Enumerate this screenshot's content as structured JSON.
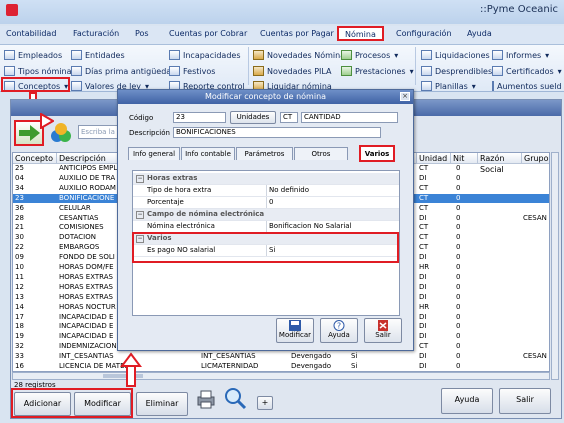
{
  "app": {
    "title": "::Pyme Oceanic"
  },
  "menu": [
    "Contabilidad",
    "Facturación",
    "Pos",
    "Cuentas por Cobrar",
    "Cuentas por Pagar",
    "Nómina",
    "Configuración",
    "Ayuda"
  ],
  "ribbon": {
    "col1": [
      "Empleados",
      "Tipos nómina",
      "Conceptos"
    ],
    "col2": [
      "Entidades",
      "Días prima antigüedad",
      "Valores de ley"
    ],
    "col3": [
      "Incapacidades",
      "Festivos",
      "Reporte control"
    ],
    "col4": [
      "Novedades Nómina",
      "Novedades PILA",
      "Liquidar nómina"
    ],
    "col5": [
      "Procesos",
      "Prestaciones"
    ],
    "col6": [
      "Liquidaciones",
      "Desprendibles",
      "Planillas"
    ],
    "col7": [
      "Informes",
      "Certificados",
      "Aumentos sueldo"
    ]
  },
  "toolbar": {
    "search_placeholder": "Escriba la"
  },
  "grid": {
    "headers": [
      "Concepto",
      "Descripción",
      "Unidad",
      "Nit",
      "Razón Social",
      "Grupo"
    ],
    "rows": [
      {
        "code": "25",
        "desc": "ANTICIPOS EMPL",
        "unit": "CT",
        "nit": "0",
        "rs": ""
      },
      {
        "code": "04",
        "desc": "AUXILIO DE TRA",
        "unit": "DI",
        "nit": "0",
        "rs": ""
      },
      {
        "code": "34",
        "desc": "AUXILIO RODAM",
        "unit": "CT",
        "nit": "0",
        "rs": ""
      },
      {
        "code": "23",
        "desc": "BONIFICACIONE",
        "unit": "CT",
        "nit": "0",
        "rs": "",
        "sel": true
      },
      {
        "code": "36",
        "desc": "CELULAR",
        "unit": "CT",
        "nit": "0",
        "rs": ""
      },
      {
        "code": "28",
        "desc": "CESANTIAS",
        "unit": "DI",
        "nit": "0",
        "rs": "CESAN"
      },
      {
        "code": "21",
        "desc": "COMISIONES",
        "unit": "CT",
        "nit": "0",
        "rs": ""
      },
      {
        "code": "30",
        "desc": "DOTACION",
        "unit": "CT",
        "nit": "0",
        "rs": ""
      },
      {
        "code": "22",
        "desc": "EMBARGOS",
        "unit": "CT",
        "nit": "0",
        "rs": ""
      },
      {
        "code": "09",
        "desc": "FONDO DE SOLI",
        "unit": "DI",
        "nit": "0",
        "rs": ""
      },
      {
        "code": "10",
        "desc": "HORAS DOM/FE",
        "unit": "HR",
        "nit": "0",
        "rs": ""
      },
      {
        "code": "11",
        "desc": "HORAS EXTRAS",
        "unit": "DI",
        "nit": "0",
        "rs": ""
      },
      {
        "code": "12",
        "desc": "HORAS EXTRAS",
        "unit": "DI",
        "nit": "0",
        "rs": ""
      },
      {
        "code": "13",
        "desc": "HORAS EXTRAS",
        "unit": "DI",
        "nit": "0",
        "rs": ""
      },
      {
        "code": "14",
        "desc": "HORAS NOCTUR",
        "unit": "HR",
        "nit": "0",
        "rs": ""
      },
      {
        "code": "17",
        "desc": "INCAPACIDAD E",
        "unit": "DI",
        "nit": "0",
        "rs": ""
      },
      {
        "code": "18",
        "desc": "INCAPACIDAD E",
        "unit": "DI",
        "nit": "0",
        "rs": ""
      },
      {
        "code": "19",
        "desc": "INCAPACIDAD E",
        "unit": "DI",
        "nit": "0",
        "rs": ""
      },
      {
        "code": "32",
        "desc": "INDEMNIZACION",
        "unit": "CT",
        "nit": "0",
        "rs": ""
      },
      {
        "code": "33",
        "desc": "INT_CESANTIAS",
        "desc2": "INT_CESANTIAS",
        "type": "Devengado",
        "si": "Si",
        "unit": "DI",
        "nit": "0",
        "rs": "CESAN"
      },
      {
        "code": "16",
        "desc": "LICENCIA DE MATERNIDAD Y/O PAT",
        "desc2": "LICMATERNIDAD",
        "type": "Devengado",
        "si": "Si",
        "unit": "DI",
        "nit": "0",
        "rs": ""
      }
    ],
    "count": "28 registros"
  },
  "dialog": {
    "title": "Modificar concepto de nómina",
    "codigo_label": "Código",
    "codigo_value": "23",
    "unidades_label": "Unidades",
    "unidad_code": "CT",
    "unidad_name": "CANTIDAD",
    "descripcion_label": "Descripción",
    "descripcion_value": "BONIFICACIONES",
    "tabs": [
      "Info general",
      "Info contable",
      "Parámetros",
      "Otros",
      "Varios"
    ],
    "props": [
      {
        "kind": "head",
        "label": "Horas extras"
      },
      {
        "label": "Tipo de hora extra",
        "value": "No definido"
      },
      {
        "label": "Porcentaje",
        "value": "0"
      },
      {
        "kind": "head",
        "label": "Campo de nómina electrónica"
      },
      {
        "label": "Nómina electrónica",
        "value": "Bonificacion No Salarial"
      },
      {
        "kind": "head",
        "label": "Varios"
      },
      {
        "label": "Es pago NO salarial",
        "value": "Si"
      }
    ],
    "buttons": {
      "modificar": "Modificar",
      "ayuda": "Ayuda",
      "salir": "Salir"
    }
  },
  "bottom": {
    "adicionar": "Adicionar",
    "modificar": "Modificar",
    "eliminar": "Eliminar",
    "plus": "+",
    "ayuda": "Ayuda",
    "salir": "Salir"
  },
  "colors": {
    "highlight": "#e01c24",
    "selection": "#3b83d6"
  }
}
